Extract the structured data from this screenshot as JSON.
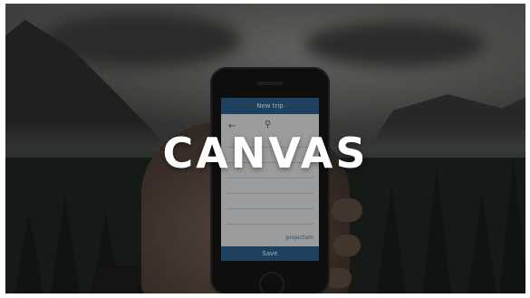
{
  "banner": {
    "title": "CANVAS"
  },
  "phone_screen": {
    "header": "New trip",
    "footer": "Save",
    "logo": "projectum"
  }
}
